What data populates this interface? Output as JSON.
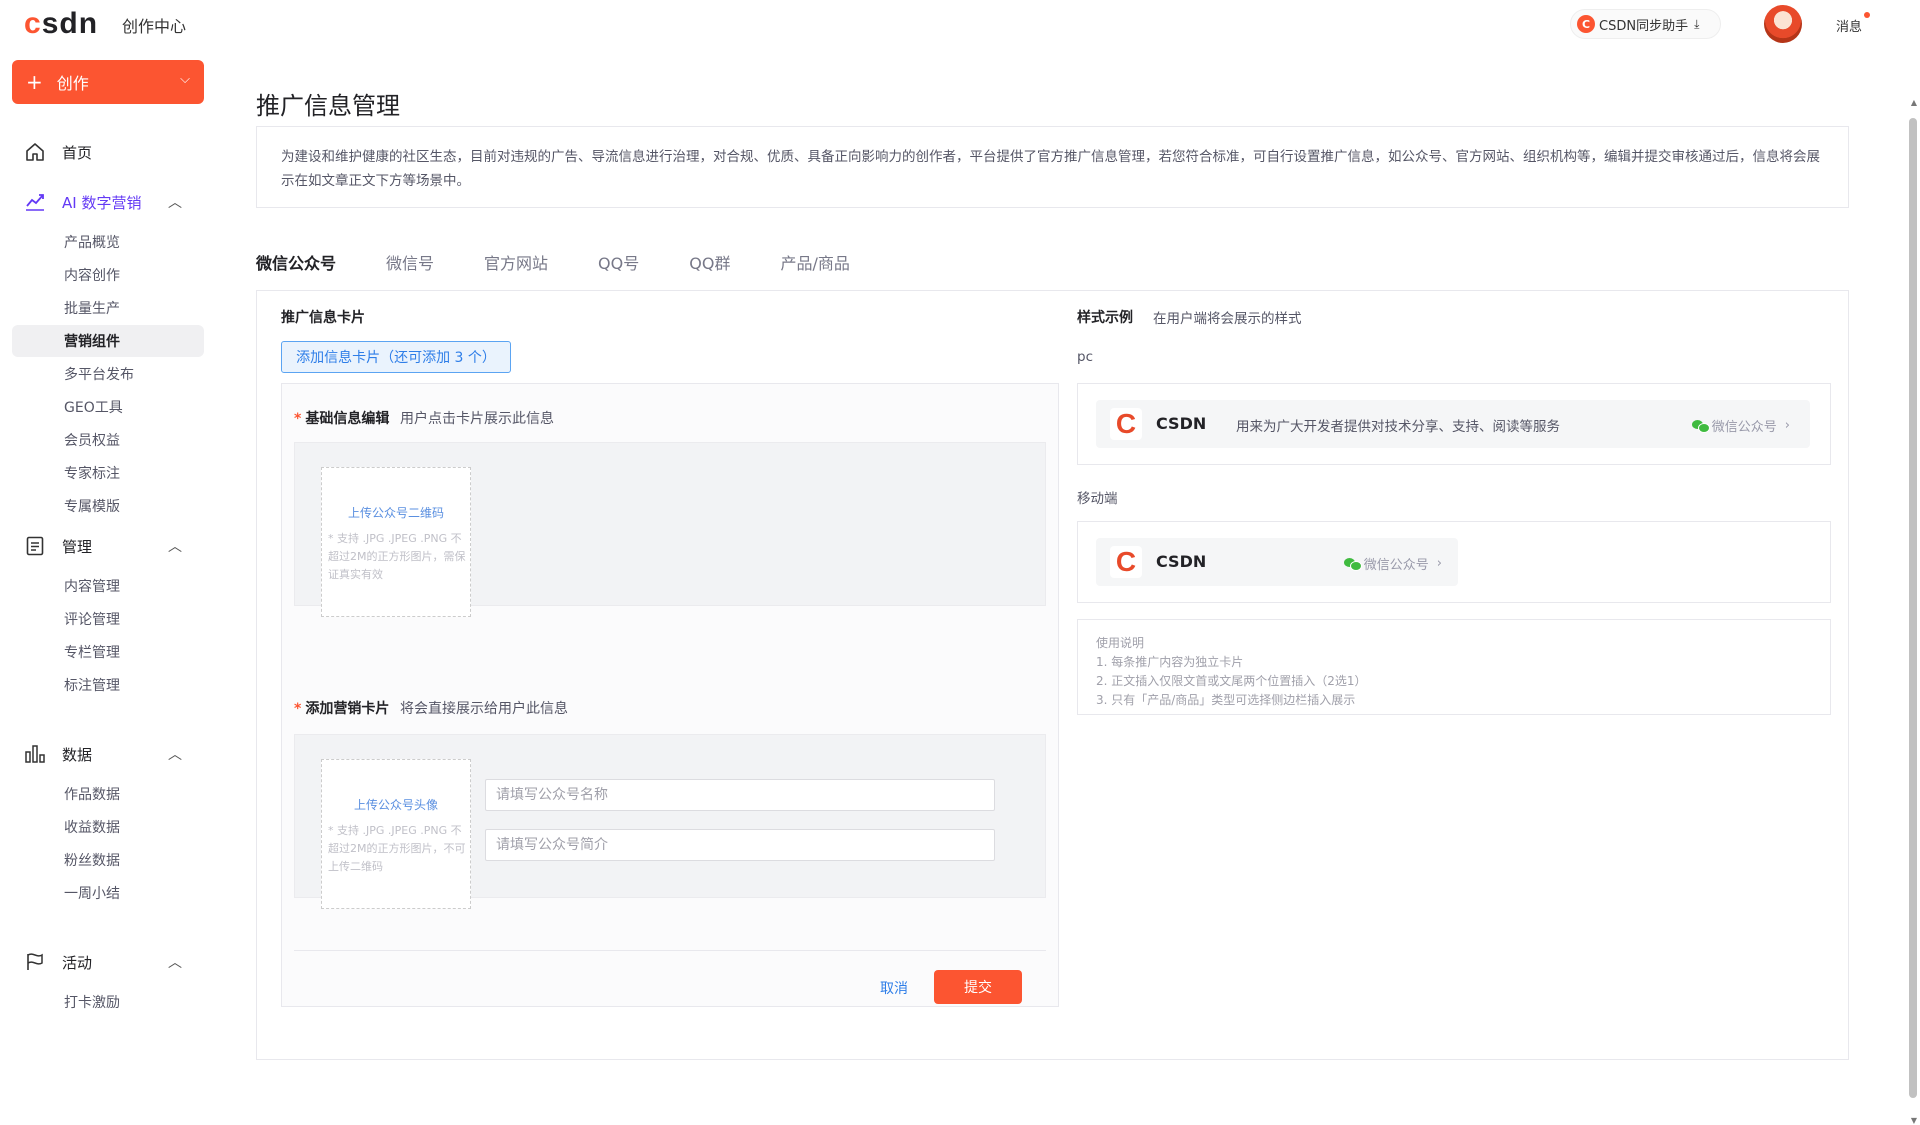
{
  "topbar": {
    "logo_c": "c",
    "logo_rest": "sdn",
    "brand_sub": "创作中心",
    "sync_label": "CSDN同步助手",
    "sync_icon": "C",
    "download_icon": "⤓",
    "message_label": "消息"
  },
  "sidebar": {
    "create_label": "创作",
    "create_plus": "+",
    "create_chevron": "⌵",
    "home": "首页",
    "ai_marketing": "AI 数字营销",
    "ai_items": [
      "产品概览",
      "内容创作",
      "批量生产",
      "营销组件",
      "多平台发布",
      "GEO工具",
      "会员权益",
      "专家标注",
      "专属模版"
    ],
    "manage": "管理",
    "manage_items": [
      "内容管理",
      "评论管理",
      "专栏管理",
      "标注管理"
    ],
    "data": "数据",
    "data_items": [
      "作品数据",
      "收益数据",
      "粉丝数据",
      "一周小结"
    ],
    "activity": "活动",
    "activity_items": [
      "打卡激励"
    ],
    "expanded_arrow": "︿"
  },
  "page": {
    "title": "推广信息管理",
    "notice": "为建设和维护健康的社区生态，目前对违规的广告、导流信息进行治理，对合规、优质、具备正向影响力的创作者，平台提供了官方推广信息管理，若您符合标准，可自行设置推广信息，如公众号、官方网站、组织机构等，编辑并提交审核通过后，信息将会展示在如文章正文下方等场景中。"
  },
  "tabs": [
    "微信公众号",
    "微信号",
    "官方网站",
    "QQ号",
    "QQ群",
    "产品/商品"
  ],
  "editor": {
    "card_title": "推广信息卡片",
    "add_card_label": "添加信息卡片（还可添加 3 个）",
    "required_mark": "*",
    "basic_title": "基础信息编辑",
    "basic_hint": "用户点击卡片展示此信息",
    "qrcode_upload_title": "上传公众号二维码",
    "qrcode_upload_desc": "* 支持 .JPG .JPEG .PNG 不超过2M的正方形图片，需保证真实有效",
    "marketing_title": "添加营销卡片",
    "marketing_hint": "将会直接展示给用户此信息",
    "avatar_upload_title": "上传公众号头像",
    "avatar_upload_desc": "* 支持 .JPG .JPEG .PNG 不超过2M的正方形图片，不可上传二维码",
    "name_placeholder": "请填写公众号名称",
    "intro_placeholder": "请填写公众号简介",
    "cancel_label": "取消",
    "submit_label": "提交"
  },
  "preview": {
    "title": "样式示例",
    "hint": "在用户端将会展示的样式",
    "pc_label": "pc",
    "mobile_label": "移动端",
    "logo_letter": "C",
    "name": "CSDN",
    "desc": "用来为广大开发者提供对技术分享、支持、阅读等服务",
    "tag": "微信公众号",
    "chevron": "›",
    "usage_title": "使用说明",
    "usage_items": [
      "1. 每条推广内容为独立卡片",
      "2. 正文插入仅限文首或文尾两个位置插入（2选1）",
      "3. 只有「产品/商品」类型可选择侧边栏插入展示"
    ]
  },
  "colors": {
    "brand": "#fc5531",
    "link": "#2e7ee8",
    "ai_purple": "#6339f5",
    "wechat_green": "#3fbb3f"
  }
}
